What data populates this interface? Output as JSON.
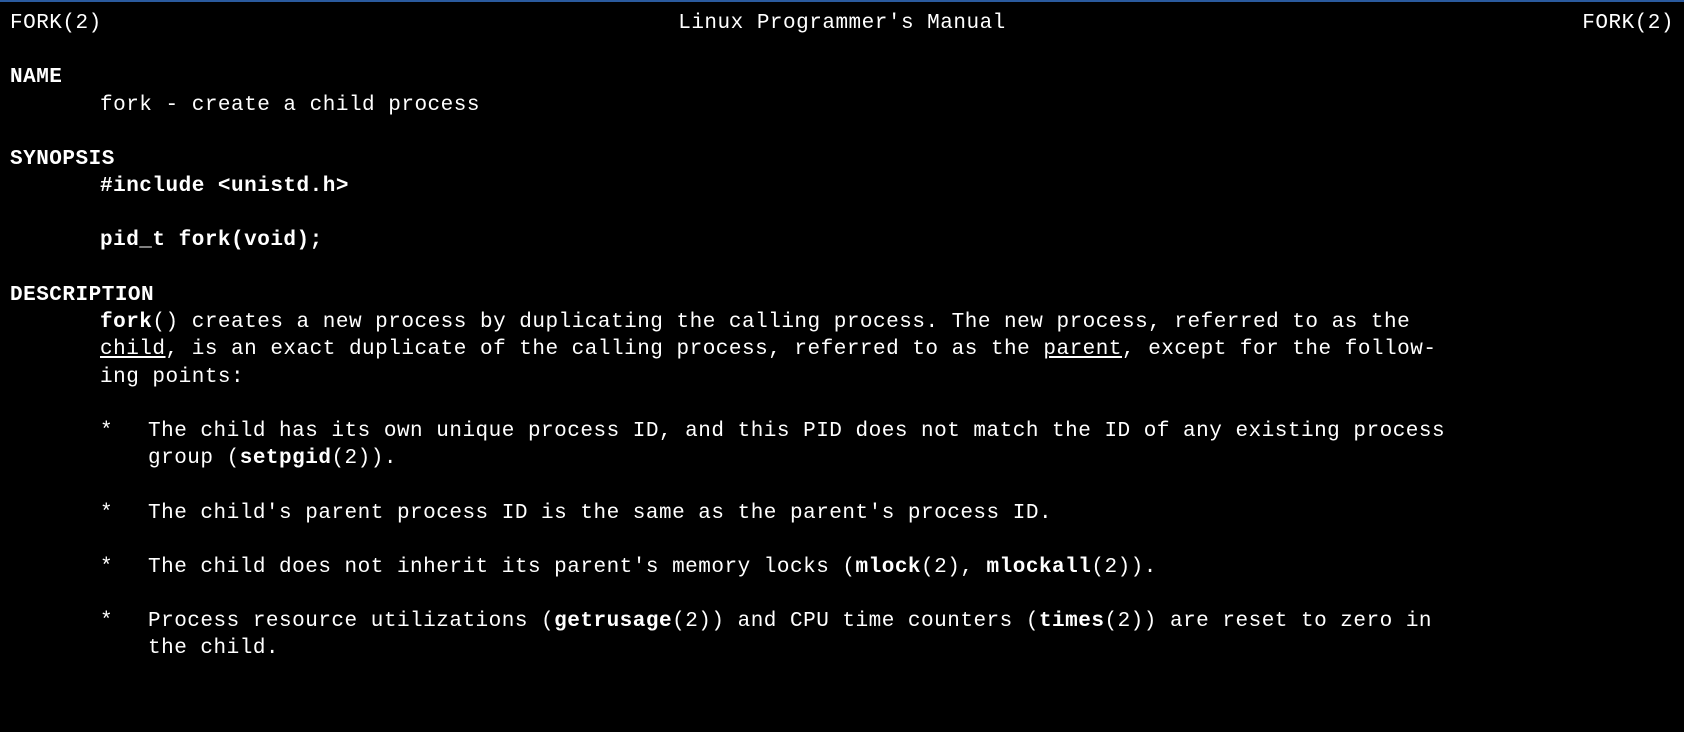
{
  "header": {
    "left": "FORK(2)",
    "center": "Linux Programmer's Manual",
    "right": "FORK(2)"
  },
  "sections": {
    "name": {
      "heading": "NAME",
      "content": "fork - create a child process"
    },
    "synopsis": {
      "heading": "SYNOPSIS",
      "include": "#include <unistd.h>",
      "signature": "pid_t fork(void);"
    },
    "description": {
      "heading": "DESCRIPTION",
      "intro": {
        "fork_bold": "fork",
        "line1_after_fork": "()  creates a new process by duplicating the calling process.  The new process, referred to as the",
        "child_underline": "child",
        "line2_mid": ", is an exact duplicate of the calling process, referred to as the ",
        "parent_underline": "parent",
        "line2_end": ", except for the follow-",
        "line3": "ing points:"
      },
      "bullets": [
        {
          "line1_pre": "The child has its own unique process ID, and this PID does not match the ID of any existing process",
          "line2_pre": "group (",
          "bold1": "setpgid",
          "line2_post": "(2))."
        },
        {
          "line1": "The child's parent process ID is the same as the parent's process ID."
        },
        {
          "pre": "The child does not inherit its parent's memory locks (",
          "bold1": "mlock",
          "mid": "(2), ",
          "bold2": "mlockall",
          "post": "(2))."
        },
        {
          "pre": "Process resource utilizations (",
          "bold1": "getrusage",
          "mid": "(2)) and CPU time counters (",
          "bold2": "times",
          "post": "(2)) are reset to zero  in",
          "line2": "the child."
        }
      ]
    }
  }
}
